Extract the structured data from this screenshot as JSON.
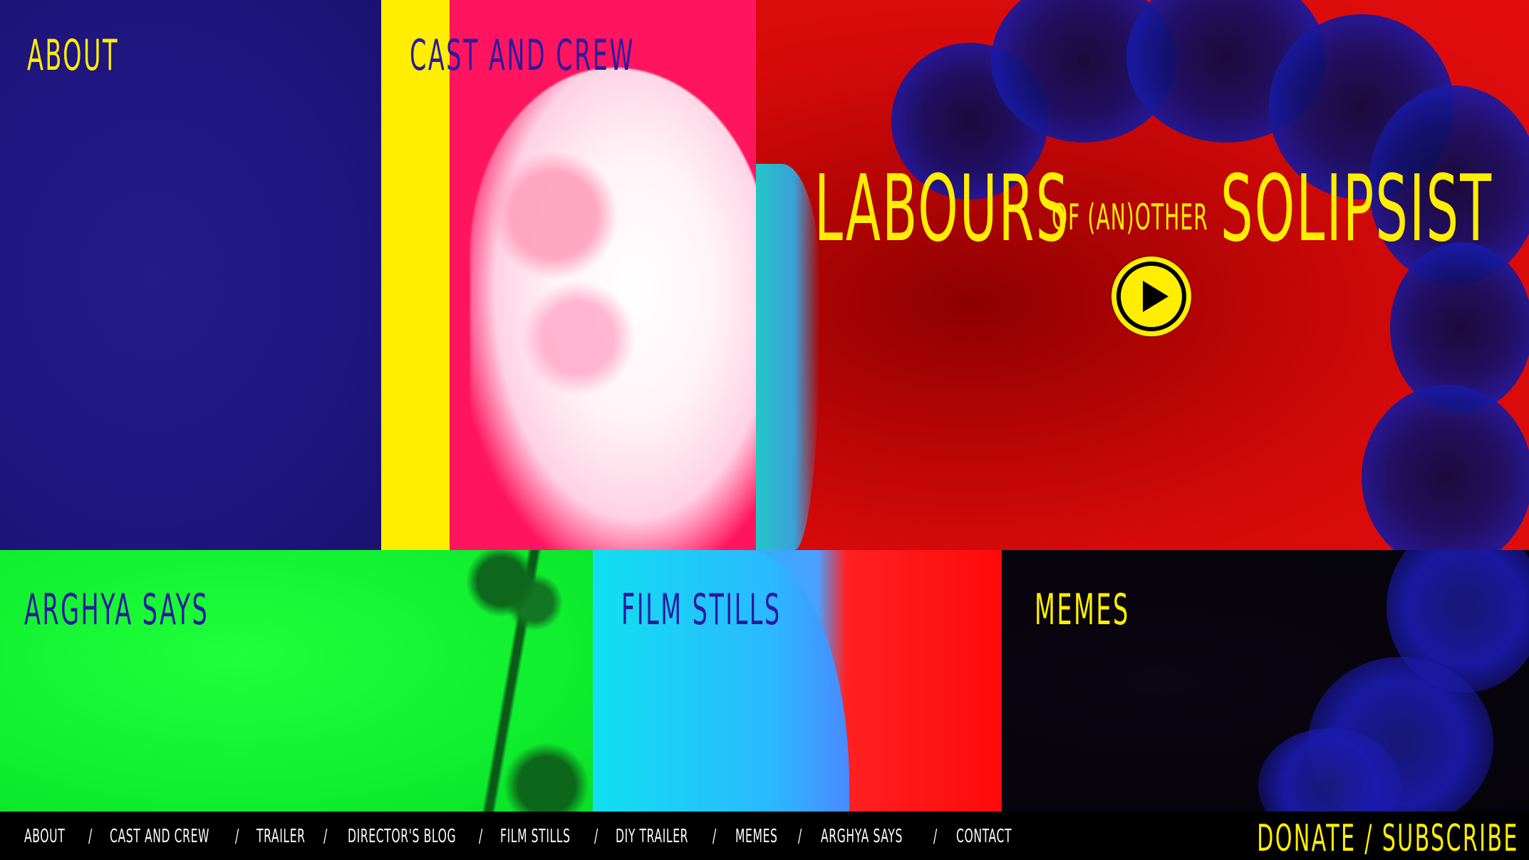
{
  "tiles": {
    "about": "ABOUT",
    "cast_and_crew": "CAST AND CREW",
    "arghya_says": "ARGHYA SAYS",
    "film_stills": "FILM STILLS",
    "memes": "MEMES"
  },
  "hero": {
    "title_word_1": "LABOURS",
    "title_connector": "OF (AN)OTHER",
    "title_word_2": "SOLIPSIST",
    "play_icon": "play-icon"
  },
  "footer": {
    "nav": [
      {
        "label": "ABOUT"
      },
      {
        "label": "CAST AND CREW"
      },
      {
        "label": "TRAILER"
      },
      {
        "label": "DIRECTOR'S BLOG"
      },
      {
        "label": "FILM STILLS"
      },
      {
        "label": "DIY TRAILER"
      },
      {
        "label": "MEMES"
      },
      {
        "label": "ARGHYA SAYS"
      },
      {
        "label": "CONTACT"
      }
    ],
    "separator": "/",
    "donate": "DONATE",
    "cta_separator": "/",
    "subscribe": "SUBSCRIBE"
  },
  "colors": {
    "accent_yellow": "#ffee00",
    "indigo": "#201680",
    "pink": "#ff1460",
    "red": "#e20d0d",
    "green": "#10f030",
    "cyan": "#19d0f5",
    "black": "#05030a"
  }
}
